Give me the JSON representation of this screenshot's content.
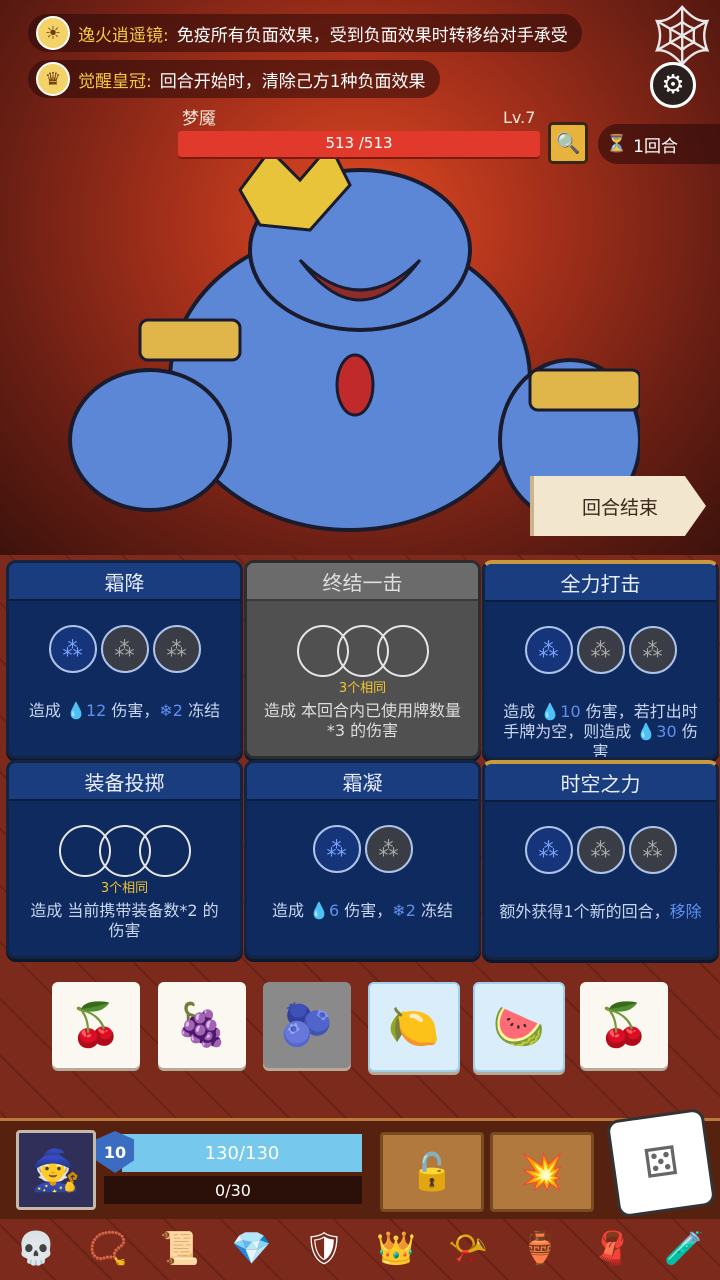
{
  "buffs": [
    {
      "name": "逸火逍遥镜:",
      "desc": "免疫所有负面效果，受到负面效果时转移给对手承受",
      "icon": "mirror-icon"
    },
    {
      "name": "觉醒皇冠:",
      "desc": "回合开始时，清除己方1种负面效果",
      "icon": "crown-icon"
    }
  ],
  "boss": {
    "name": "梦魇",
    "level": "Lv.7",
    "hp": "513 /513",
    "hp_fraction": 1.0
  },
  "round": "1回合",
  "end_turn": "回合结束",
  "cards": [
    {
      "title": "霜降",
      "slots": [
        "blue",
        "gray",
        "gray"
      ],
      "same": "",
      "desc_a": "造成 ",
      "num1": "💧12",
      "desc_b": " 伤害，",
      "num2": "❄2",
      "desc_c": " 冻结",
      "style": "blue"
    },
    {
      "title": "终结一击",
      "slots": [
        "empty",
        "empty",
        "empty"
      ],
      "same": "3个相同",
      "desc_a": "造成 本回合内已使用牌数量*3 的伤害",
      "num1": "",
      "desc_b": "",
      "num2": "",
      "desc_c": "",
      "style": "gray"
    },
    {
      "title": "全力打击",
      "slots": [
        "blue",
        "gray",
        "gray"
      ],
      "same": "",
      "desc_a": "造成 ",
      "num1": "💧10",
      "desc_b": " 伤害，若打出时手牌为空，则造成 ",
      "num2": "💧30",
      "desc_c": " 伤害",
      "style": "gold"
    },
    {
      "title": "装备投掷",
      "slots": [
        "empty",
        "empty",
        "empty"
      ],
      "same": "3个相同",
      "desc_a": "造成 当前携带装备数*2 的伤害",
      "num1": "",
      "desc_b": "",
      "num2": "",
      "desc_c": "",
      "style": "blue"
    },
    {
      "title": "霜凝",
      "slots": [
        "blue",
        "gray"
      ],
      "same": "",
      "desc_a": "造成 ",
      "num1": "💧6",
      "desc_b": " 伤害，",
      "num2": "❄2",
      "desc_c": " 冻结",
      "style": "blue"
    },
    {
      "title": "时空之力",
      "slots": [
        "blue",
        "gray",
        "gray"
      ],
      "same": "",
      "desc_a": "额外获得1个新的回合，",
      "num1": "",
      "desc_b": "",
      "num2": "移除",
      "desc_c": "",
      "style": "gold"
    }
  ],
  "dice": [
    {
      "face": "🍒",
      "style": "white"
    },
    {
      "face": "🍇",
      "style": "white"
    },
    {
      "face": "🫐",
      "style": "gray"
    },
    {
      "face": "🍋",
      "style": "frozen"
    },
    {
      "face": "🍉",
      "style": "frozen"
    },
    {
      "face": "🍒",
      "style": "white"
    }
  ],
  "player": {
    "level": "10",
    "hp": "130/130",
    "exp": "0/30"
  },
  "inventory": [
    "skull-icon",
    "bracelet-icon",
    "scroll-icon",
    "crystal-icon",
    "armor-icon",
    "crown-icon",
    "horn-icon",
    "vase-icon",
    "hood-icon",
    "potion-icon"
  ],
  "colors": {
    "accent_gold": "#f5c842",
    "card_blue": "#0e2a5e",
    "hp_red": "#e13a2c",
    "player_hp": "#76c8ec"
  }
}
